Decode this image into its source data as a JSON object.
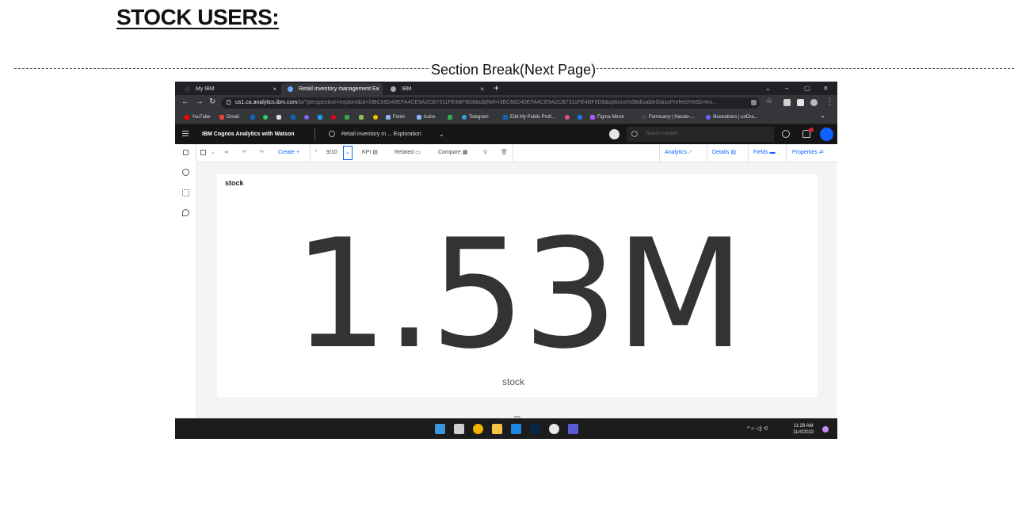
{
  "document": {
    "heading": "STOCK USERS:",
    "section_break": "Section Break(Next Page)"
  },
  "browser": {
    "tabs": [
      {
        "label": "My IBM",
        "active": false
      },
      {
        "label": "Retail inventory management Ex",
        "active": true
      },
      {
        "label": "IBM",
        "active": false
      }
    ],
    "new_tab": "+",
    "url_host": "us1.ca.analytics.ibm.com",
    "url_rest": "/bi/?perspective=explore&id=i3BC66D40EFA4CE9A2CB7311FE4BF9D8&objRef=i3BC66D40EFA4CE9A2CB7311FE4BF9D8&options%5BdisableGlassPrefetch%5D=tru...",
    "bookmarks": [
      {
        "label": "YouTube",
        "color": "#ff0000"
      },
      {
        "label": "Gmail",
        "color": "#ea4335"
      },
      {
        "label": "Fonts",
        "color": "#8ab4f8"
      },
      {
        "label": "Icons",
        "color": "#8ab4f8"
      },
      {
        "label": "Telegram",
        "color": "#2aa3df"
      },
      {
        "label": "Edit My Public Profi...",
        "color": "#0a66c2"
      },
      {
        "label": "Figma Mirror",
        "color": "#a259ff"
      },
      {
        "label": "Formcarry | Hassle-...",
        "color": "#444444"
      },
      {
        "label": "Illustrations | unDra...",
        "color": "#6c63ff"
      }
    ]
  },
  "app": {
    "title": "IBM Cognos Analytics with Watson",
    "breadcrumb": "Retail inventory m ... Exploration",
    "search_placeholder": "Search content"
  },
  "toolbar": {
    "create": "Create",
    "create_plus": "+",
    "page_counter": "9/10",
    "kpi": "KPI",
    "related": "Related",
    "compare": "Compare",
    "analytics": "Analytics",
    "details": "Details",
    "fields": "Fields",
    "properties": "Properties"
  },
  "card": {
    "title": "stock",
    "kpi_value": "1.53M",
    "kpi_label": "stock"
  },
  "taskbar": {
    "time": "11:29 AM",
    "date": "11/4/2022",
    "tray_icons": "^ ≈ ◁) ⟲"
  },
  "colors": {
    "accent": "#0f62fe",
    "header_bg": "#161616",
    "kpi_text": "#333333"
  }
}
